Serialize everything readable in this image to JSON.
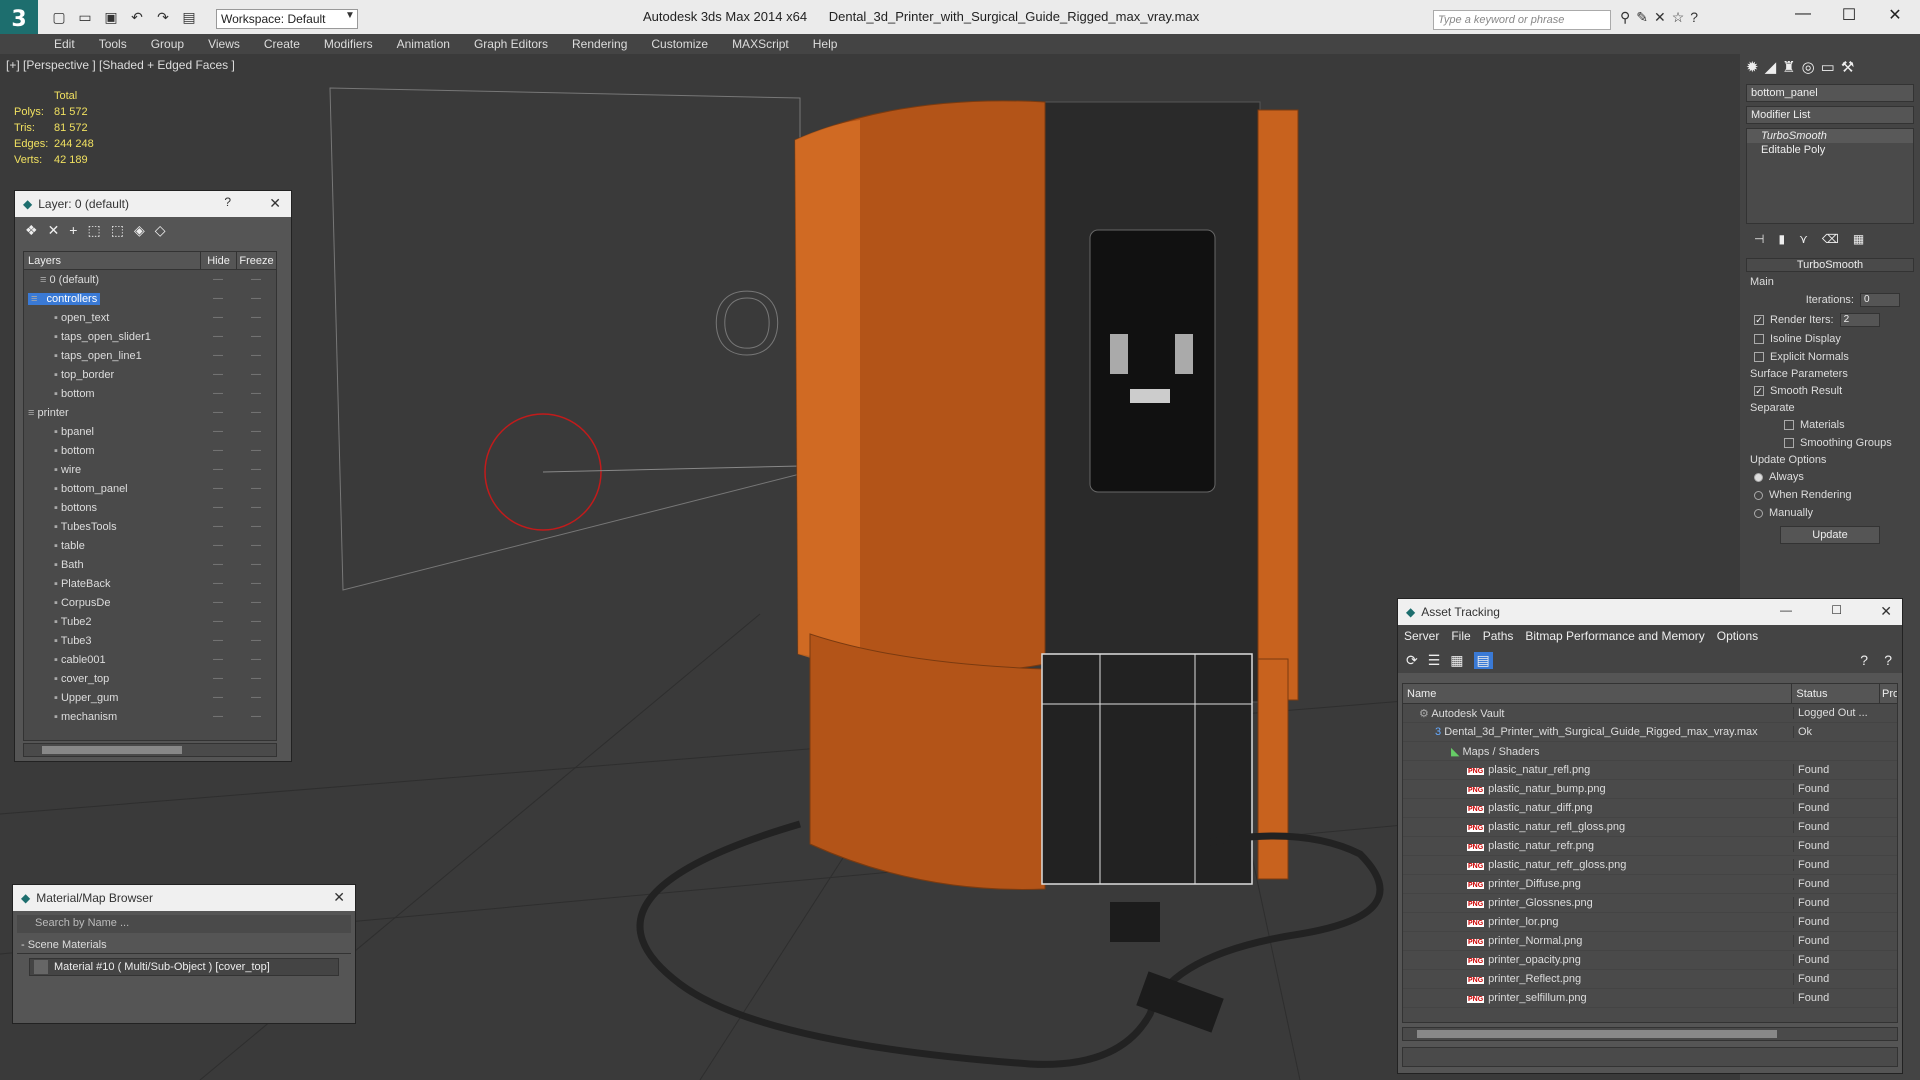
{
  "app": {
    "title": "Autodesk 3ds Max  2014 x64",
    "filename": "Dental_3d_Printer_with_Surgical_Guide_Rigged_max_vray.max",
    "workspace": "Workspace: Default",
    "search_placeholder": "Type a keyword or phrase"
  },
  "menu": [
    "Edit",
    "Tools",
    "Group",
    "Views",
    "Create",
    "Modifiers",
    "Animation",
    "Graph Editors",
    "Rendering",
    "Customize",
    "MAXScript",
    "Help"
  ],
  "viewport": {
    "label": "[+] [Perspective ] [Shaded + Edged Faces ]",
    "stats": {
      "total_label": "Total",
      "polys_label": "Polys:",
      "polys": "81 572",
      "tris_label": "Tris:",
      "tris": "81 572",
      "edges_label": "Edges:",
      "edges": "244 248",
      "verts_label": "Verts:",
      "verts": "42 189"
    }
  },
  "layer_panel": {
    "title": "Layer: 0 (default)",
    "help": "?",
    "col_layers": "Layers",
    "col_hide": "Hide",
    "col_freeze": "Freeze",
    "rows": [
      {
        "name": "0 (default)",
        "level": 1
      },
      {
        "name": "controllers",
        "level": 0
      },
      {
        "name": "open_text",
        "level": 2
      },
      {
        "name": "taps_open_slider1",
        "level": 2
      },
      {
        "name": "taps_open_line1",
        "level": 2
      },
      {
        "name": "top_border",
        "level": 2
      },
      {
        "name": "bottom",
        "level": 2
      },
      {
        "name": "printer",
        "level": 0
      },
      {
        "name": "bpanel",
        "level": 2
      },
      {
        "name": "bottom",
        "level": 2
      },
      {
        "name": "wire",
        "level": 2
      },
      {
        "name": "bottom_panel",
        "level": 2
      },
      {
        "name": "bottons",
        "level": 2
      },
      {
        "name": "TubesTools",
        "level": 2
      },
      {
        "name": "table",
        "level": 2
      },
      {
        "name": "Bath",
        "level": 2
      },
      {
        "name": "PlateBack",
        "level": 2
      },
      {
        "name": "CorpusDe",
        "level": 2
      },
      {
        "name": "Tube2",
        "level": 2
      },
      {
        "name": "Tube3",
        "level": 2
      },
      {
        "name": "cable001",
        "level": 2
      },
      {
        "name": "cover_top",
        "level": 2
      },
      {
        "name": "Upper_gum",
        "level": 2
      },
      {
        "name": "mechanism",
        "level": 2
      }
    ]
  },
  "material_browser": {
    "title": "Material/Map Browser",
    "search": "Search by Name ...",
    "section": "- Scene Materials",
    "item": "Material #10  ( Multi/Sub-Object )  [cover_top]"
  },
  "command_panel": {
    "object_name": "bottom_panel",
    "modifier_list": "Modifier List",
    "stack": [
      "TurboSmooth",
      "Editable Poly"
    ],
    "rollout": "TurboSmooth",
    "main_label": "Main",
    "iterations_label": "Iterations:",
    "iterations": "0",
    "render_iters_label": "Render Iters:",
    "render_iters": "2",
    "isoline": "Isoline Display",
    "explicit": "Explicit Normals",
    "surface_label": "Surface Parameters",
    "smooth_result": "Smooth Result",
    "separate_label": "Separate",
    "materials": "Materials",
    "smoothing_groups": "Smoothing Groups",
    "update_label": "Update Options",
    "always": "Always",
    "when_rendering": "When Rendering",
    "manually": "Manually",
    "update_btn": "Update"
  },
  "asset_tracking": {
    "title": "Asset Tracking",
    "menu": [
      "Server",
      "File",
      "Paths",
      "Bitmap Performance and Memory",
      "Options"
    ],
    "col_name": "Name",
    "col_status": "Status",
    "col_p": "Pro",
    "rows": [
      {
        "name": "Autodesk Vault",
        "status": "Logged Out ...",
        "indent": 1,
        "kind": "vault"
      },
      {
        "name": "Dental_3d_Printer_with_Surgical_Guide_Rigged_max_vray.max",
        "status": "Ok",
        "indent": 2,
        "kind": "max"
      },
      {
        "name": "Maps / Shaders",
        "status": "",
        "indent": 3,
        "kind": "maps"
      },
      {
        "name": "plasic_natur_refl.png",
        "status": "Found",
        "indent": 4,
        "kind": "png"
      },
      {
        "name": "plastic_natur_bump.png",
        "status": "Found",
        "indent": 4,
        "kind": "png"
      },
      {
        "name": "plastic_natur_diff.png",
        "status": "Found",
        "indent": 4,
        "kind": "png"
      },
      {
        "name": "plastic_natur_refl_gloss.png",
        "status": "Found",
        "indent": 4,
        "kind": "png"
      },
      {
        "name": "plastic_natur_refr.png",
        "status": "Found",
        "indent": 4,
        "kind": "png"
      },
      {
        "name": "plastic_natur_refr_gloss.png",
        "status": "Found",
        "indent": 4,
        "kind": "png"
      },
      {
        "name": "printer_Diffuse.png",
        "status": "Found",
        "indent": 4,
        "kind": "png"
      },
      {
        "name": "printer_Glossnes.png",
        "status": "Found",
        "indent": 4,
        "kind": "png"
      },
      {
        "name": "printer_lor.png",
        "status": "Found",
        "indent": 4,
        "kind": "png"
      },
      {
        "name": "printer_Normal.png",
        "status": "Found",
        "indent": 4,
        "kind": "png"
      },
      {
        "name": "printer_opacity.png",
        "status": "Found",
        "indent": 4,
        "kind": "png"
      },
      {
        "name": "printer_Reflect.png",
        "status": "Found",
        "indent": 4,
        "kind": "png"
      },
      {
        "name": "printer_selfillum.png",
        "status": "Found",
        "indent": 4,
        "kind": "png"
      }
    ]
  },
  "colors": {
    "accent": "#3a7ad6",
    "orange_shell": "#c8621e",
    "stats_yellow": "#f0e060"
  }
}
